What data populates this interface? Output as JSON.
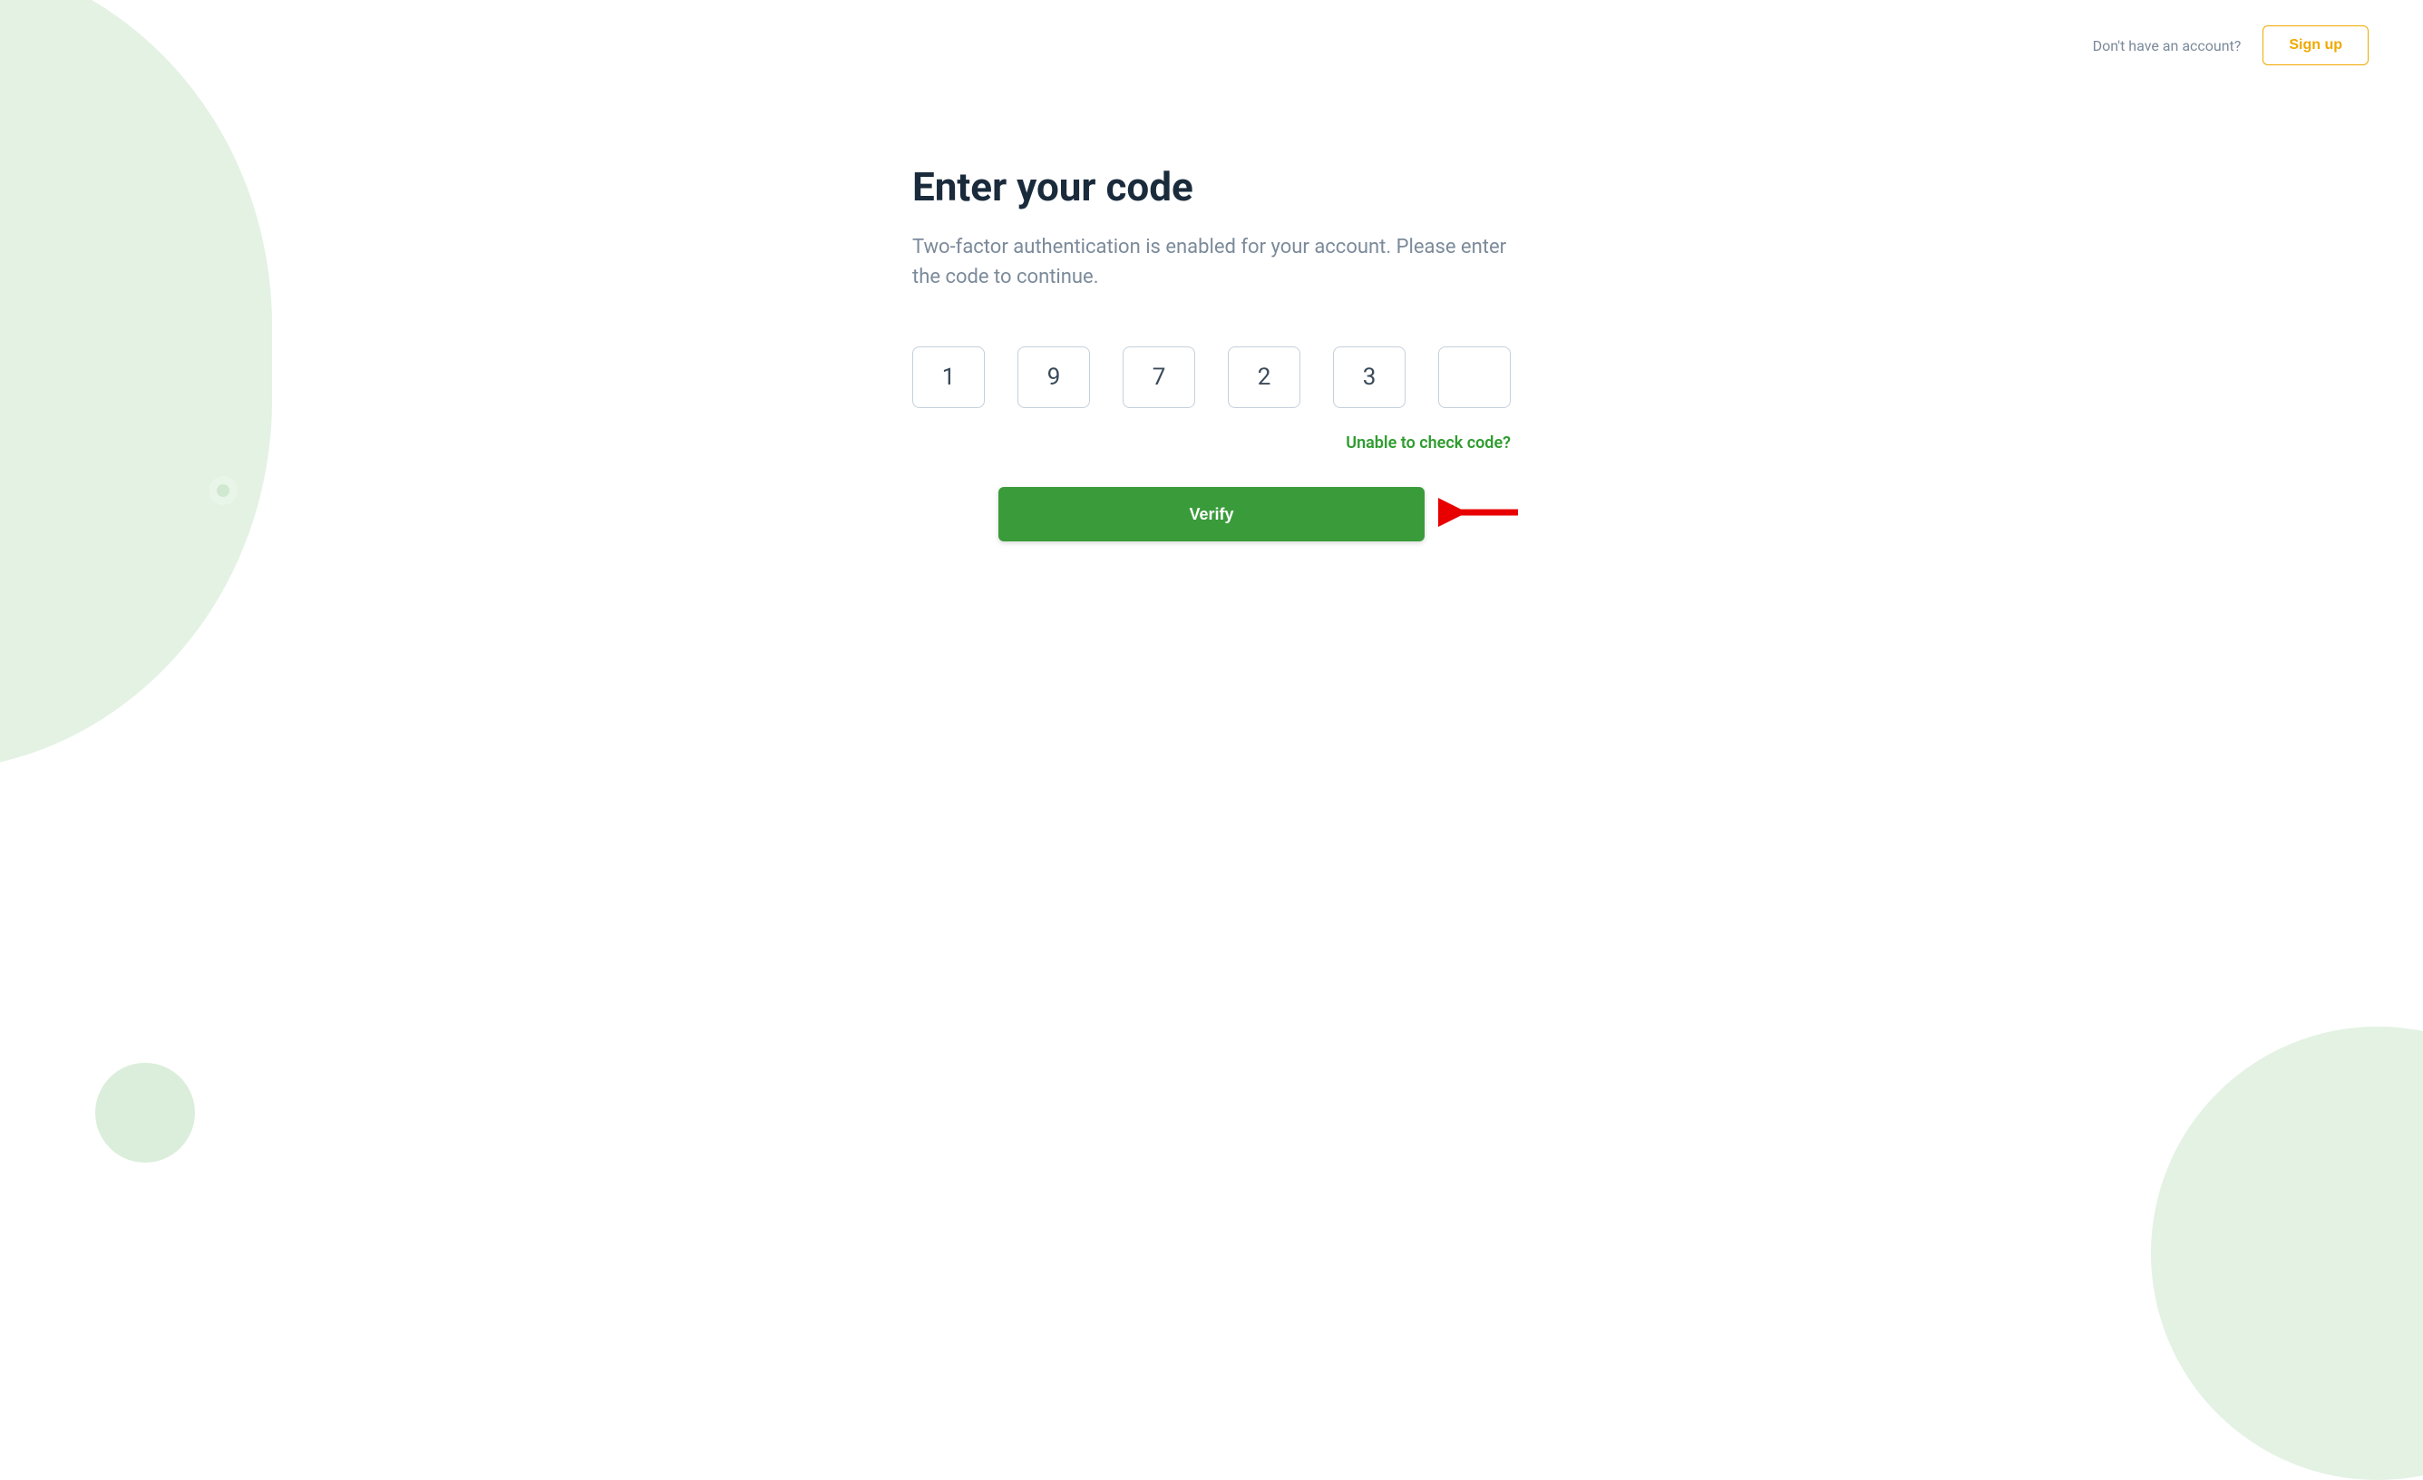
{
  "header": {
    "prompt_text": "Don't have an account?",
    "signup_label": "Sign up"
  },
  "main": {
    "title": "Enter your code",
    "subtitle": "Two-factor authentication is enabled for your account. Please enter the code to continue.",
    "code_digits": [
      "1",
      "9",
      "7",
      "2",
      "3",
      ""
    ],
    "help_link": "Unable to check code?",
    "verify_label": "Verify"
  },
  "colors": {
    "accent_green": "#3a9b3a",
    "accent_orange": "#f0a900",
    "bg_light_green": "#e3f2e3",
    "text_dark": "#1a2b3c",
    "text_muted": "#7b8a9a",
    "annotation_red": "#e80000"
  }
}
